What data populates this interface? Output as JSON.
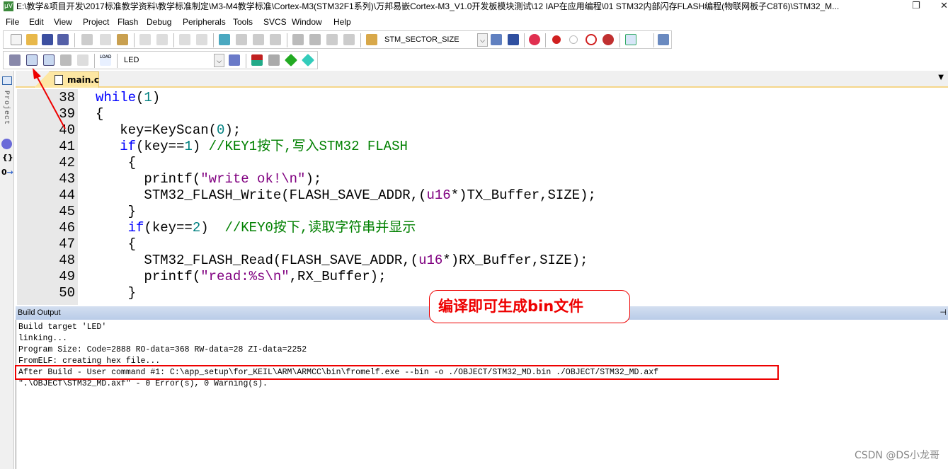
{
  "window": {
    "title": "E:\\教学&项目开发\\2017标准教学资料\\教学标准制定\\M3-M4教学标准\\Cortex-M3(STM32F1系列)\\万邦易嵌Cortex-M3_V1.0开发板模块测试\\12 IAP在应用编程\\01 STM32内部闪存FLASH编程(物联网板子C8T6)\\STM32_M...",
    "app_icon": "µV"
  },
  "menu": [
    "File",
    "Edit",
    "View",
    "Project",
    "Flash",
    "Debug",
    "Peripherals",
    "Tools",
    "SVCS",
    "Window",
    "Help"
  ],
  "toolbar": {
    "find_combo": "STM_SECTOR_SIZE",
    "target_combo": "LED",
    "load_label": "LOAD"
  },
  "sidebar": {
    "project_label": "Project"
  },
  "editor": {
    "tab": "main.c",
    "lines": [
      {
        "n": "38",
        "t": [
          [
            "while",
            "kw"
          ],
          [
            "(",
            "pl"
          ],
          [
            "1",
            "num"
          ],
          [
            ")",
            "pl"
          ]
        ]
      },
      {
        "n": "39",
        "t": [
          [
            "{",
            "pl"
          ]
        ]
      },
      {
        "n": "40",
        "t": [
          [
            "   key=KeyScan(",
            "pl"
          ],
          [
            "0",
            "num"
          ],
          [
            ");",
            "pl"
          ]
        ]
      },
      {
        "n": "41",
        "t": [
          [
            "   if",
            "kw"
          ],
          [
            "(key==",
            "pl"
          ],
          [
            "1",
            "num"
          ],
          [
            ") ",
            "pl"
          ],
          [
            "//KEY1按下,写入STM32 FLASH",
            "cm"
          ]
        ]
      },
      {
        "n": "42",
        "t": [
          [
            "    {",
            "pl"
          ]
        ]
      },
      {
        "n": "43",
        "t": [
          [
            "      printf(",
            "pl"
          ],
          [
            "\"write ok!\\n\"",
            "str"
          ],
          [
            ");",
            "pl"
          ]
        ]
      },
      {
        "n": "44",
        "t": [
          [
            "      STM32_FLASH_Write(FLASH_SAVE_ADDR,(",
            "pl"
          ],
          [
            "u16",
            "str"
          ],
          [
            "*)TX_Buffer,SIZE);",
            "pl"
          ]
        ]
      },
      {
        "n": "45",
        "t": [
          [
            "    }",
            "pl"
          ]
        ]
      },
      {
        "n": "46",
        "t": [
          [
            "    if",
            "kw"
          ],
          [
            "(key==",
            "pl"
          ],
          [
            "2",
            "num"
          ],
          [
            ")  ",
            "pl"
          ],
          [
            "//KEY0按下,读取字符串并显示",
            "cm"
          ]
        ]
      },
      {
        "n": "47",
        "t": [
          [
            "    {",
            "pl"
          ]
        ]
      },
      {
        "n": "48",
        "t": [
          [
            "      STM32_FLASH_Read(FLASH_SAVE_ADDR,(",
            "pl"
          ],
          [
            "u16",
            "str"
          ],
          [
            "*)RX_Buffer,SIZE);",
            "pl"
          ]
        ]
      },
      {
        "n": "49",
        "t": [
          [
            "      printf(",
            "pl"
          ],
          [
            "\"read:%s\\n\"",
            "str"
          ],
          [
            ",RX_Buffer);",
            "pl"
          ]
        ]
      },
      {
        "n": "50",
        "t": [
          [
            "    }",
            "pl"
          ]
        ]
      }
    ]
  },
  "build_output": {
    "title": "Build Output",
    "lines": [
      "Build target 'LED'",
      "linking...",
      "Program Size: Code=2888 RO-data=368 RW-data=28 ZI-data=2252",
      "FromELF: creating hex file...",
      "After Build - User command #1: C:\\app_setup\\for_KEIL\\ARM\\ARMCC\\bin\\fromelf.exe --bin -o ./OBJECT/STM32_MD.bin ./OBJECT/STM32_MD.axf",
      "\".\\OBJECT\\STM32_MD.axf\" - 0 Error(s), 0 Warning(s)."
    ]
  },
  "annotation": {
    "callout": "编译即可生成bin文件",
    "color": "#e00000"
  },
  "watermark": "CSDN @DS小龙哥"
}
